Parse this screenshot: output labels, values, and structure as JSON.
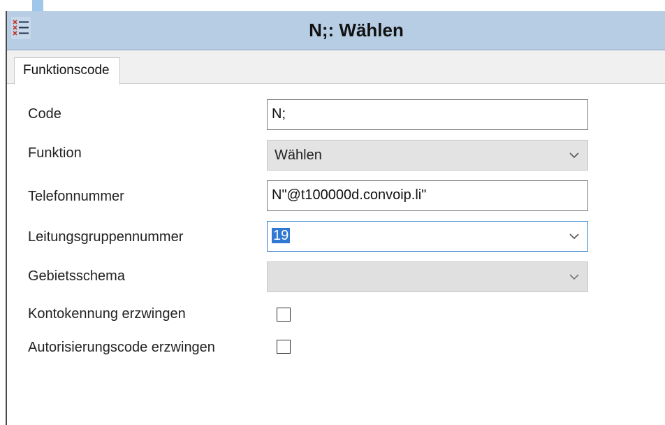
{
  "window": {
    "title": "N;: Wählen"
  },
  "tabs": [
    {
      "label": "Funktionscode"
    }
  ],
  "form": {
    "code": {
      "label": "Code",
      "value": "N;"
    },
    "funktion": {
      "label": "Funktion",
      "value": "Wählen"
    },
    "telefonnummer": {
      "label": "Telefonnummer",
      "value": "N\"@t100000d.convoip.li\""
    },
    "leitungsgruppennummer": {
      "label": "Leitungsgruppennummer",
      "value": "19"
    },
    "gebietsschema": {
      "label": "Gebietsschema",
      "value": ""
    },
    "kontokennung": {
      "label": "Kontokennung erzwingen",
      "checked": false
    },
    "autorisierungscode": {
      "label": "Autorisierungscode erzwingen",
      "checked": false
    }
  },
  "icons": {
    "app": "list-icon",
    "dropdown": "chevron-down-icon"
  },
  "colors": {
    "title_bar": "#b6cde3",
    "selection": "#2f78d4",
    "focus_border": "#2f7fd0"
  }
}
